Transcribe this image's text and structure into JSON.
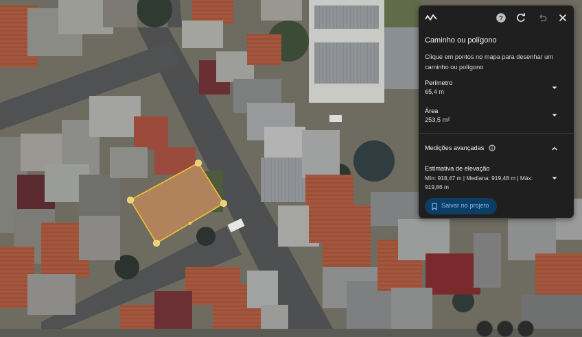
{
  "panel": {
    "title": "Caminho ou polígono",
    "instruction": "Clique em pontos no mapa para desenhar um caminho ou polígono",
    "perimeter": {
      "label": "Perímetro",
      "value": "65,4 m"
    },
    "area": {
      "label": "Área",
      "value": "253,5 m²"
    },
    "advanced": {
      "label": "Medições avançadas"
    },
    "elevation": {
      "label": "Estimativa de elevação",
      "stats": "Mín: 918,47 m | Mediana: 919,48 m | Máx: 919,86 m"
    },
    "save_label": "Salvar no projeto"
  },
  "icons": {
    "ruler": "ruler-icon",
    "help": "help-icon",
    "reload": "reload-icon",
    "undo": "undo-icon",
    "close": "close-icon",
    "bookmark": "bookmark-icon",
    "info": "info-icon"
  },
  "colors": {
    "panel_bg": "#1f1f1f",
    "polygon": "#f2c230",
    "save_button_bg": "#0b3e64",
    "save_button_text": "#8ab4f8"
  }
}
